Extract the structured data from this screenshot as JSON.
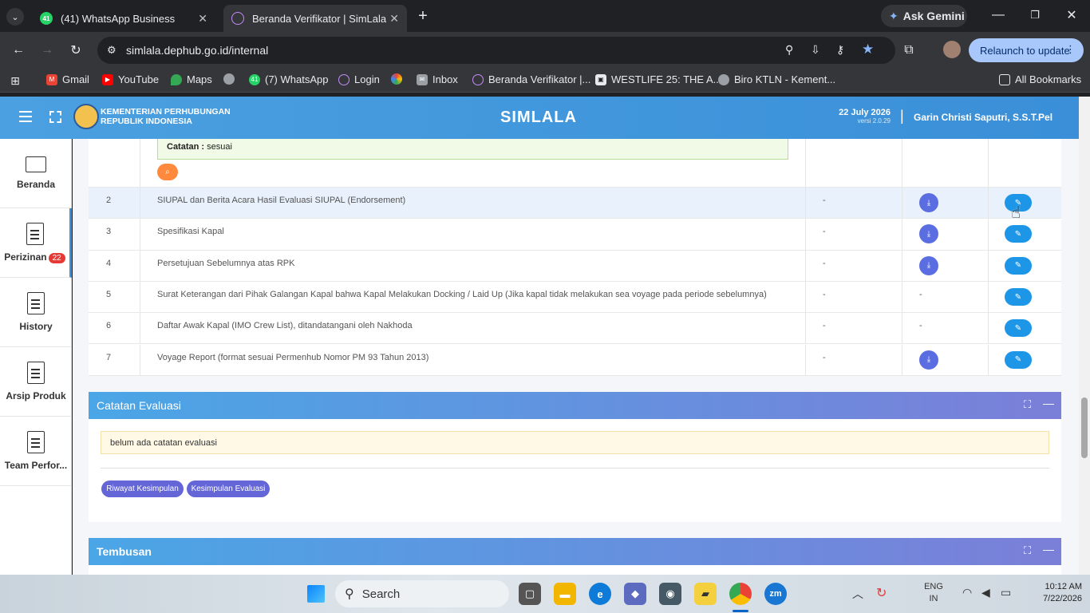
{
  "browser": {
    "tabs": [
      {
        "label": "(41) WhatsApp Business",
        "badge": "41",
        "active": false
      },
      {
        "label": "Beranda Verifikator | SimLala",
        "active": true
      }
    ],
    "new_tab": "+",
    "ask_gemini": "Ask Gemini",
    "url": "simlala.dephub.go.id/internal",
    "relaunch": "Relaunch to update",
    "bookmarks": [
      {
        "label": "Gmail",
        "icon": "gmail-icon",
        "color": "#ea4335"
      },
      {
        "label": "YouTube",
        "icon": "youtube-icon",
        "color": "#ff0000"
      },
      {
        "label": "Maps",
        "icon": "maps-icon",
        "color": "#34a853"
      },
      {
        "label": "",
        "icon": "globe-icon",
        "color": "#9aa0a6"
      },
      {
        "label": "(7) WhatsApp",
        "icon": "whatsapp-icon",
        "color": "#25d366",
        "badge": "41"
      },
      {
        "label": "Login",
        "icon": "simlala-icon",
        "color": "#c58af9"
      },
      {
        "label": "",
        "icon": "photos-icon",
        "color": "#fbbc04"
      },
      {
        "label": "Inbox",
        "icon": "mail-icon",
        "color": "#9aa0a6"
      },
      {
        "label": "Beranda Verifikator |...",
        "icon": "simlala-icon",
        "color": "#c58af9"
      },
      {
        "label": "WESTLIFE 25: THE A...",
        "icon": "page-icon",
        "color": "#e8eaed"
      },
      {
        "label": "Biro KTLN - Kement...",
        "icon": "globe-icon",
        "color": "#9aa0a6"
      }
    ],
    "all_bookmarks": "All Bookmarks"
  },
  "app": {
    "org_line1": "KEMENTERIAN PERHUBUNGAN",
    "org_line2": "REPUBLIK INDONESIA",
    "title": "SIMLALA",
    "date": "22 July 2026",
    "version": "versi 2.0.29",
    "separator": "|",
    "user": "Garin Christi Saputri, S.S.T.Pel"
  },
  "sidebar": [
    {
      "label": "Beranda",
      "icon": "monitor-icon"
    },
    {
      "label": "Perizinan",
      "icon": "document-icon",
      "badge": "22"
    },
    {
      "label": "History",
      "icon": "document-icon"
    },
    {
      "label": "Arsip Produk",
      "icon": "document-icon"
    },
    {
      "label": "Team Perfor...",
      "icon": "document-icon"
    }
  ],
  "note_box": {
    "label": "Catatan :",
    "value": "sesuai"
  },
  "documents": [
    {
      "no": "2",
      "name": "SIUPAL dan Berita Acara Hasil Evaluasi SIUPAL (Endorsement)",
      "status": "-",
      "download": true
    },
    {
      "no": "3",
      "name": "Spesifikasi Kapal",
      "status": "-",
      "download": true
    },
    {
      "no": "4",
      "name": "Persetujuan Sebelumnya atas RPK",
      "status": "-",
      "download": true
    },
    {
      "no": "5",
      "name": "Surat Keterangan dari Pihak Galangan Kapal bahwa Kapal Melakukan Docking / Laid Up (Jika kapal tidak melakukan sea voyage pada periode sebelumnya)",
      "status": "-",
      "download": false,
      "download_text": "-"
    },
    {
      "no": "6",
      "name": "Daftar Awak Kapal (IMO Crew List), ditandatangani oleh Nakhoda",
      "status": "-",
      "download": false,
      "download_text": "-"
    },
    {
      "no": "7",
      "name": "Voyage Report (format sesuai Permenhub Nomor PM 93 Tahun 2013)",
      "status": "-",
      "download": true
    }
  ],
  "evaluasi": {
    "title": "Catatan Evaluasi",
    "message": "belum ada catatan evaluasi",
    "btn_riwayat": "Riwayat Kesimpulan",
    "btn_kesimpulan": "Kesimpulan Evaluasi"
  },
  "tembusan": {
    "title": "Tembusan"
  },
  "taskbar": {
    "search": "Search",
    "lang1": "ENG",
    "lang2": "IN",
    "time": "10:12 AM",
    "date": "7/22/2026"
  }
}
